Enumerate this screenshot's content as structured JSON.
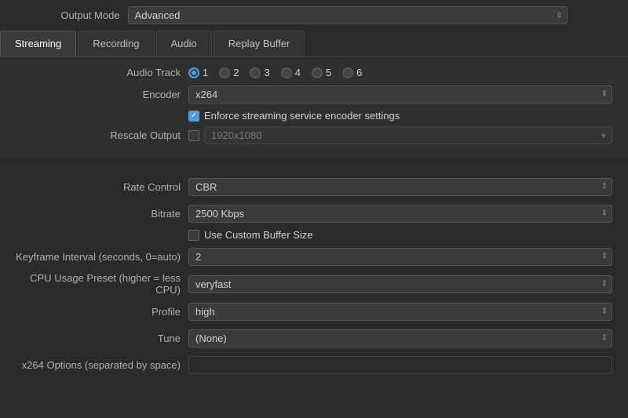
{
  "outputMode": {
    "label": "Output Mode",
    "value": "Advanced"
  },
  "tabs": [
    {
      "id": "streaming",
      "label": "Streaming",
      "active": true
    },
    {
      "id": "recording",
      "label": "Recording",
      "active": false
    },
    {
      "id": "audio",
      "label": "Audio",
      "active": false
    },
    {
      "id": "replay-buffer",
      "label": "Replay Buffer",
      "active": false
    }
  ],
  "streaming": {
    "audioTrack": {
      "label": "Audio Track",
      "tracks": [
        "1",
        "2",
        "3",
        "4",
        "5",
        "6"
      ],
      "selected": "1"
    },
    "encoder": {
      "label": "Encoder",
      "value": "x264"
    },
    "enforceCheckbox": {
      "label": "Enforce streaming service encoder settings",
      "checked": true
    },
    "rescaleOutput": {
      "label": "Rescale Output",
      "checked": false,
      "placeholder": "1920x1080"
    },
    "rateControl": {
      "label": "Rate Control",
      "value": "CBR"
    },
    "bitrate": {
      "label": "Bitrate",
      "value": "2500 Kbps"
    },
    "customBufferCheckbox": {
      "label": "Use Custom Buffer Size",
      "checked": false
    },
    "keyframeInterval": {
      "label": "Keyframe Interval (seconds, 0=auto)",
      "value": "2"
    },
    "cpuUsagePreset": {
      "label": "CPU Usage Preset (higher = less CPU)",
      "value": "veryfast"
    },
    "profile": {
      "label": "Profile",
      "value": "high"
    },
    "tune": {
      "label": "Tune",
      "value": "(None)"
    },
    "x264Options": {
      "label": "x264 Options (separated by space)",
      "value": ""
    }
  }
}
